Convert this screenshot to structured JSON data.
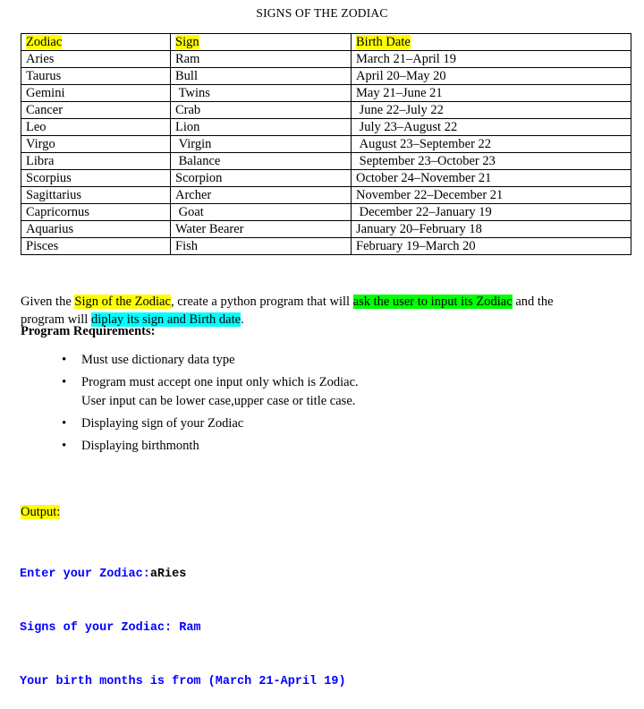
{
  "document": {
    "title": "SIGNS OF THE ZODIAC"
  },
  "table": {
    "headers": [
      "Zodiac",
      "Sign",
      "Birth Date"
    ],
    "rows": [
      {
        "zodiac": "Aries",
        "sign": "Ram",
        "date": "March 21–April 19"
      },
      {
        "zodiac": "Taurus",
        "sign": "Bull",
        "date": "April 20–May 20"
      },
      {
        "zodiac": "Gemini",
        "sign": "Twins",
        "date": "May 21–June 21"
      },
      {
        "zodiac": "Cancer",
        "sign": "Crab",
        "date": "June 22–July 22"
      },
      {
        "zodiac": "Leo",
        "sign": "Lion",
        "date": "July 23–August 22"
      },
      {
        "zodiac": "Virgo",
        "sign": "Virgin",
        "date": "August 23–September 22"
      },
      {
        "zodiac": "Libra",
        "sign": "Balance",
        "date": "September 23–October 23"
      },
      {
        "zodiac": "Scorpius",
        "sign": "Scorpion",
        "date": "October 24–November 21"
      },
      {
        "zodiac": "Sagittarius",
        "sign": "Archer",
        "date": "November 22–December 21"
      },
      {
        "zodiac": "Capricornus",
        "sign": "Goat",
        "date": "December 22–January 19"
      },
      {
        "zodiac": "Aquarius",
        "sign": "Water Bearer",
        "date": "January 20–February 18"
      },
      {
        "zodiac": "Pisces",
        "sign": "Fish",
        "date": "February 19–March 20"
      }
    ]
  },
  "intro": {
    "seg1": "Given the ",
    "seg2_highlight_yellow": "Sign of the Zodiac",
    "seg3": ", create a python program that will ",
    "seg4_highlight_green": "ask the user to input its Zodiac",
    "seg5": " and the program will ",
    "seg6_highlight_cyan": "diplay its sign and Birth date",
    "seg7": "."
  },
  "requirements": {
    "heading": "Program Requirements:",
    "items": [
      {
        "text": "Must use dictionary data type",
        "sub": ""
      },
      {
        "text": "Program must accept one input only which is Zodiac.",
        "sub": "User input can be lower case,upper case or title case."
      },
      {
        "text": "Displaying sign of your Zodiac",
        "sub": ""
      },
      {
        "text": "Displaying birthmonth",
        "sub": ""
      }
    ]
  },
  "output": {
    "label": "Output:",
    "lines": [
      {
        "prompt": "Enter your Zodiac:",
        "user_input": "aRies"
      },
      {
        "prompt": "Signs of your Zodiac: Ram",
        "user_input": ""
      },
      {
        "prompt": "Your birth months is from (March 21-April 19)",
        "user_input": ""
      }
    ]
  },
  "colors": {
    "highlight_yellow": "#FFFF00",
    "highlight_green": "#00FF00",
    "highlight_cyan": "#00FFFF",
    "console_text": "#0000FF",
    "user_input_text": "#000000"
  }
}
